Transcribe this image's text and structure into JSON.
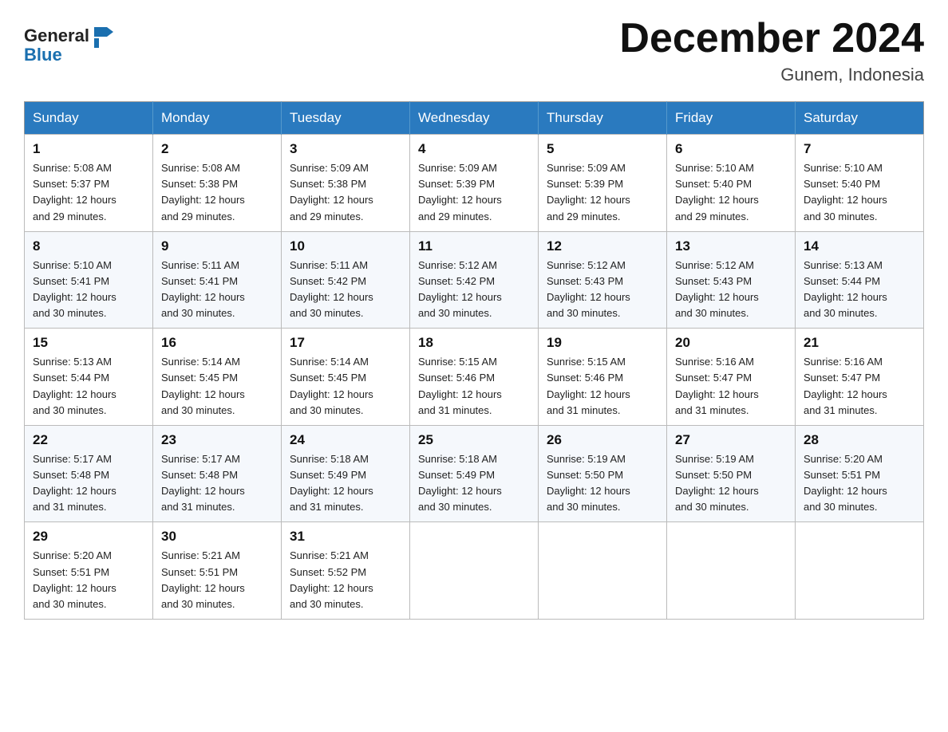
{
  "header": {
    "logo_general": "General",
    "logo_blue": "Blue",
    "month_title": "December 2024",
    "location": "Gunem, Indonesia"
  },
  "days_of_week": [
    "Sunday",
    "Monday",
    "Tuesday",
    "Wednesday",
    "Thursday",
    "Friday",
    "Saturday"
  ],
  "weeks": [
    [
      {
        "day": "1",
        "sunrise": "5:08 AM",
        "sunset": "5:37 PM",
        "daylight": "12 hours and 29 minutes."
      },
      {
        "day": "2",
        "sunrise": "5:08 AM",
        "sunset": "5:38 PM",
        "daylight": "12 hours and 29 minutes."
      },
      {
        "day": "3",
        "sunrise": "5:09 AM",
        "sunset": "5:38 PM",
        "daylight": "12 hours and 29 minutes."
      },
      {
        "day": "4",
        "sunrise": "5:09 AM",
        "sunset": "5:39 PM",
        "daylight": "12 hours and 29 minutes."
      },
      {
        "day": "5",
        "sunrise": "5:09 AM",
        "sunset": "5:39 PM",
        "daylight": "12 hours and 29 minutes."
      },
      {
        "day": "6",
        "sunrise": "5:10 AM",
        "sunset": "5:40 PM",
        "daylight": "12 hours and 29 minutes."
      },
      {
        "day": "7",
        "sunrise": "5:10 AM",
        "sunset": "5:40 PM",
        "daylight": "12 hours and 30 minutes."
      }
    ],
    [
      {
        "day": "8",
        "sunrise": "5:10 AM",
        "sunset": "5:41 PM",
        "daylight": "12 hours and 30 minutes."
      },
      {
        "day": "9",
        "sunrise": "5:11 AM",
        "sunset": "5:41 PM",
        "daylight": "12 hours and 30 minutes."
      },
      {
        "day": "10",
        "sunrise": "5:11 AM",
        "sunset": "5:42 PM",
        "daylight": "12 hours and 30 minutes."
      },
      {
        "day": "11",
        "sunrise": "5:12 AM",
        "sunset": "5:42 PM",
        "daylight": "12 hours and 30 minutes."
      },
      {
        "day": "12",
        "sunrise": "5:12 AM",
        "sunset": "5:43 PM",
        "daylight": "12 hours and 30 minutes."
      },
      {
        "day": "13",
        "sunrise": "5:12 AM",
        "sunset": "5:43 PM",
        "daylight": "12 hours and 30 minutes."
      },
      {
        "day": "14",
        "sunrise": "5:13 AM",
        "sunset": "5:44 PM",
        "daylight": "12 hours and 30 minutes."
      }
    ],
    [
      {
        "day": "15",
        "sunrise": "5:13 AM",
        "sunset": "5:44 PM",
        "daylight": "12 hours and 30 minutes."
      },
      {
        "day": "16",
        "sunrise": "5:14 AM",
        "sunset": "5:45 PM",
        "daylight": "12 hours and 30 minutes."
      },
      {
        "day": "17",
        "sunrise": "5:14 AM",
        "sunset": "5:45 PM",
        "daylight": "12 hours and 30 minutes."
      },
      {
        "day": "18",
        "sunrise": "5:15 AM",
        "sunset": "5:46 PM",
        "daylight": "12 hours and 31 minutes."
      },
      {
        "day": "19",
        "sunrise": "5:15 AM",
        "sunset": "5:46 PM",
        "daylight": "12 hours and 31 minutes."
      },
      {
        "day": "20",
        "sunrise": "5:16 AM",
        "sunset": "5:47 PM",
        "daylight": "12 hours and 31 minutes."
      },
      {
        "day": "21",
        "sunrise": "5:16 AM",
        "sunset": "5:47 PM",
        "daylight": "12 hours and 31 minutes."
      }
    ],
    [
      {
        "day": "22",
        "sunrise": "5:17 AM",
        "sunset": "5:48 PM",
        "daylight": "12 hours and 31 minutes."
      },
      {
        "day": "23",
        "sunrise": "5:17 AM",
        "sunset": "5:48 PM",
        "daylight": "12 hours and 31 minutes."
      },
      {
        "day": "24",
        "sunrise": "5:18 AM",
        "sunset": "5:49 PM",
        "daylight": "12 hours and 31 minutes."
      },
      {
        "day": "25",
        "sunrise": "5:18 AM",
        "sunset": "5:49 PM",
        "daylight": "12 hours and 30 minutes."
      },
      {
        "day": "26",
        "sunrise": "5:19 AM",
        "sunset": "5:50 PM",
        "daylight": "12 hours and 30 minutes."
      },
      {
        "day": "27",
        "sunrise": "5:19 AM",
        "sunset": "5:50 PM",
        "daylight": "12 hours and 30 minutes."
      },
      {
        "day": "28",
        "sunrise": "5:20 AM",
        "sunset": "5:51 PM",
        "daylight": "12 hours and 30 minutes."
      }
    ],
    [
      {
        "day": "29",
        "sunrise": "5:20 AM",
        "sunset": "5:51 PM",
        "daylight": "12 hours and 30 minutes."
      },
      {
        "day": "30",
        "sunrise": "5:21 AM",
        "sunset": "5:51 PM",
        "daylight": "12 hours and 30 minutes."
      },
      {
        "day": "31",
        "sunrise": "5:21 AM",
        "sunset": "5:52 PM",
        "daylight": "12 hours and 30 minutes."
      },
      null,
      null,
      null,
      null
    ]
  ],
  "labels": {
    "sunrise": "Sunrise:",
    "sunset": "Sunset:",
    "daylight": "Daylight:"
  }
}
